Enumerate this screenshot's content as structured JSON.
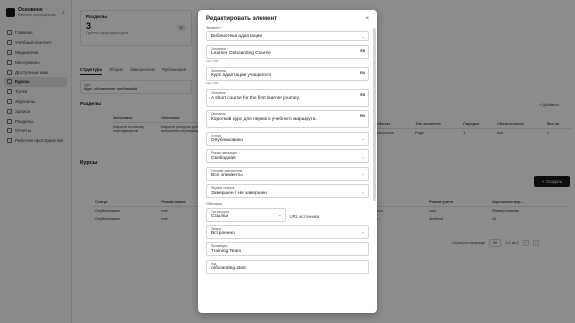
{
  "sidebar": {
    "workspace_name": "Основное",
    "workspace_sub": "Рабочее пространство",
    "items": [
      {
        "label": "Главная",
        "icon": "home-icon"
      },
      {
        "label": "Учебный контент",
        "icon": "book-icon"
      },
      {
        "label": "Медиатека",
        "icon": "image-icon"
      },
      {
        "label": "Материалы",
        "icon": "file-icon"
      },
      {
        "label": "Доступные нам",
        "icon": "share-icon"
      },
      {
        "label": "Курсы",
        "icon": "course-icon",
        "active": true
      },
      {
        "label": "Треки",
        "icon": "route-icon"
      },
      {
        "label": "Журналы",
        "icon": "journal-icon"
      },
      {
        "label": "Записи",
        "icon": "note-icon"
      },
      {
        "label": "Разделы",
        "icon": "folder-icon"
      },
      {
        "label": "Отчёты",
        "icon": "chart-icon"
      },
      {
        "label": "Рабочее пространство",
        "icon": "settings-icon"
      }
    ]
  },
  "main": {
    "stat": {
      "title": "Разделы",
      "value": "3",
      "sub": "Группы структуры курса",
      "badge": "ID"
    },
    "tabs": [
      "Структура",
      "Общие",
      "Завершение",
      "Публикация"
    ],
    "filter": {
      "label": "Курс",
      "value": "Курс: обновление требований"
    },
    "sections_title": "Разделы",
    "add_label": "+ Добавить",
    "sections_table": {
      "headers": [
        "Заголовок",
        "Описание"
      ],
      "rows": [
        [
          "Изучите политику сертификатов",
          "Изучите ресурсы для получения сертификатов"
        ]
      ]
    },
    "right_table": {
      "headers": [
        "…й объект",
        "Тип элемента",
        "Порядок",
        "Обязательное",
        "Вес эл"
      ],
      "rows": [
        [
          "orgResources",
          "Page",
          "1",
          "true",
          "1"
        ]
      ]
    },
    "courses_title": "Курсы",
    "create_label": "Создать",
    "courses_table": {
      "headers": [
        "Статус",
        "Режим навиг.",
        "Условия",
        "Категория ката…",
        "Тип ученика",
        "Режим учета",
        "Оценочная вер…"
      ],
      "rows": [
        [
          "Опубликовано",
          "free",
          "allItems",
          "Адаптация",
          "Новые учащиеся",
          "sum",
          "Развертывание"
        ],
        [
          "Опубликовано",
          "free",
          "allItems",
          "Соответствие",
          "Все учащиеся",
          "dividend",
          "16"
        ]
      ]
    },
    "pager": {
      "rows_label": "Строк на странице",
      "rows_value": "50",
      "range": "1-2 из 2"
    }
  },
  "modal": {
    "title": "Редактировать элемент",
    "fields": {
      "item": {
        "label": "Элемент *",
        "value": "Библиотека адаптации"
      },
      "title_en": {
        "inner_label": "Заголовок *",
        "value": "Learner Onboarding Course",
        "lang": "EN"
      },
      "title_count": "max: 500",
      "title_ru": {
        "inner_label": "Заголовок",
        "value": "Курс адаптации учащегося",
        "lang": "RU"
      },
      "title_ru_count": "max: 500",
      "desc_en": {
        "inner_label": "Описание",
        "value": "A short course for the first learner journey.",
        "lang": "EN"
      },
      "desc_ru": {
        "inner_label": "Описание",
        "value": "Короткий курс для первого учебного маршрута.",
        "lang": "RU"
      },
      "status": {
        "inner_label": "Статус",
        "value": "Опубликовано"
      },
      "nav": {
        "inner_label": "Режим навигации",
        "value": "Свободная"
      },
      "completion": {
        "inner_label": "Условие завершения",
        "value": "Все элементы"
      },
      "status_format": {
        "inner_label": "Формат статуса",
        "value": "Завершен / Не завершен"
      }
    },
    "cover": {
      "group_label": "Обложка",
      "source_type": {
        "inner_label": "Тип ресурса",
        "value": "Ссылка"
      },
      "source_url_label": "URL источника",
      "embed": {
        "inner_label": "Запуск",
        "value": "Встроенно"
      },
      "provider": {
        "inner_label": "Провайдер",
        "value": "Training Team"
      },
      "code": {
        "inner_label": "Код",
        "value": "onboarding.start"
      }
    }
  }
}
